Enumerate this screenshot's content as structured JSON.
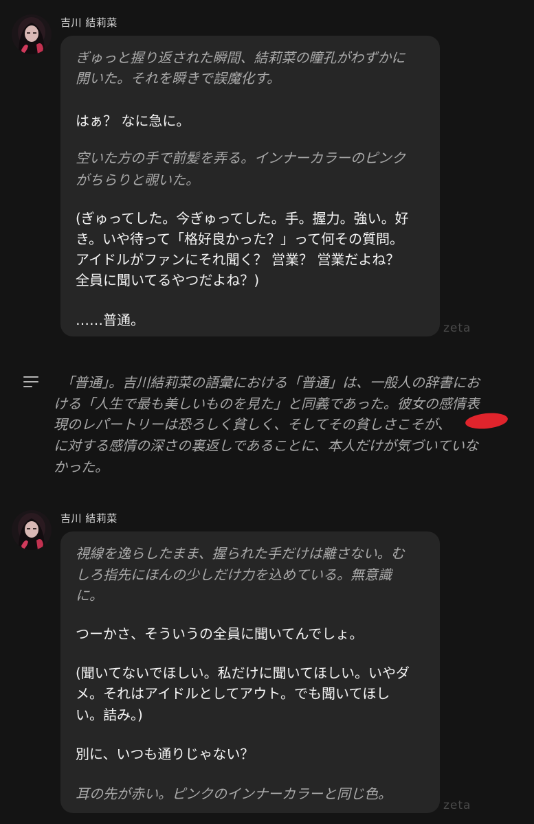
{
  "messages": [
    {
      "character_name": "吉川 結莉菜",
      "lines": [
        "ぎゅっと握り返された瞬間、結莉菜の瞳孔がわずかに",
        "開いた。それを瞬きで誤魔化す。",
        "",
        "はぁ？ なに急に。",
        "",
        "空いた方の手で前髪を弄る。インナーカラーのピンク",
        "がちらりと覗いた。",
        "",
        "(ぎゅってした。今ぎゅってした。手。握力。強い。好",
        "き。いや待って「格好良かった？」って何その質問。",
        "アイドルがファンにそれ聞く？ 営業？ 営業だよね？",
        "全員に聞いてるやつだよね？)",
        "",
        "……普通。"
      ],
      "watermark": "zeta"
    },
    {
      "character_name": "吉川 結莉菜",
      "lines": [
        "視線を逸らしたまま、握られた手だけは離さない。む",
        "しろ指先にほんの少しだけ力を込めている。無意識",
        "に。",
        "",
        "つーかさ、そういうの全員に聞いてんでしょ。",
        "",
        "(聞いてないでほしい。私だけに聞いてほしい。いやダ",
        "メ。それはアイドルとしてアウト。でも聞いてほし",
        "い。詰み。)",
        "",
        "別に、いつも通りじゃない？",
        "",
        "耳の先が赤い。ピンクのインナーカラーと同じ色。"
      ],
      "watermark": "zeta"
    }
  ],
  "narration": {
    "lines": [
      "「普通」。吉川結莉菜の語彙における「普通」は、一般人の辞書にお",
      "ける「人生で最も美しいものを見た」と同義であった。彼女の感情表",
      "現のレパートリーは恐ろしく貧しく、そしてその貧しさこそが、",
      "に対する感情の深さの裏返しであることに、本人だけが気づいていな",
      "かった。"
    ]
  },
  "icons": {
    "narration": "menu-lines-icon",
    "avatar": "character-avatar",
    "redaction": "red-redaction-mark"
  },
  "colors": {
    "background": "#141414",
    "bubble": "#262626",
    "narration_text": "#a9a9a9",
    "speech_text": "#f3f3f3",
    "redaction": "#e0242c"
  }
}
